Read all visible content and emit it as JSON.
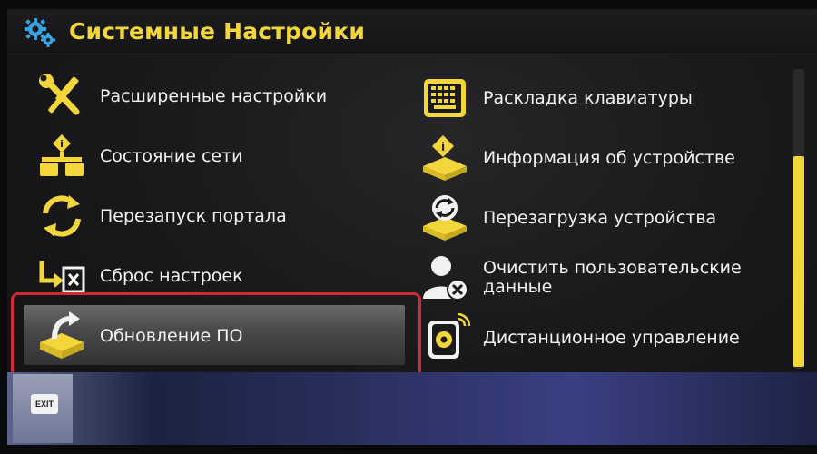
{
  "header": {
    "title": "Системные Настройки"
  },
  "menu": {
    "left": [
      {
        "label": "Расширенные настройки",
        "icon": "wrench-screwdriver-icon"
      },
      {
        "label": "Состояние сети",
        "icon": "network-status-icon"
      },
      {
        "label": "Перезапуск портала",
        "icon": "restart-arrows-icon"
      },
      {
        "label": "Сброс настроек",
        "icon": "reset-settings-icon"
      },
      {
        "label": "Обновление ПО",
        "icon": "software-update-icon"
      }
    ],
    "right": [
      {
        "label": "Раскладка клавиатуры",
        "icon": "keyboard-icon"
      },
      {
        "label": "Информация об устройстве",
        "icon": "device-info-icon"
      },
      {
        "label": "Перезагрузка устройства",
        "icon": "device-reboot-icon"
      },
      {
        "label_line1": "Очистить пользовательские",
        "label_line2": "данные",
        "icon": "clear-user-data-icon"
      },
      {
        "label": "Дистанционное управление",
        "icon": "remote-control-icon"
      }
    ],
    "selected_index": 4
  },
  "footer": {
    "exit_label": "EXIT"
  },
  "colors": {
    "accent": "#f3d63a",
    "highlight_frame": "#d22a35",
    "text": "#f2f2f2"
  }
}
